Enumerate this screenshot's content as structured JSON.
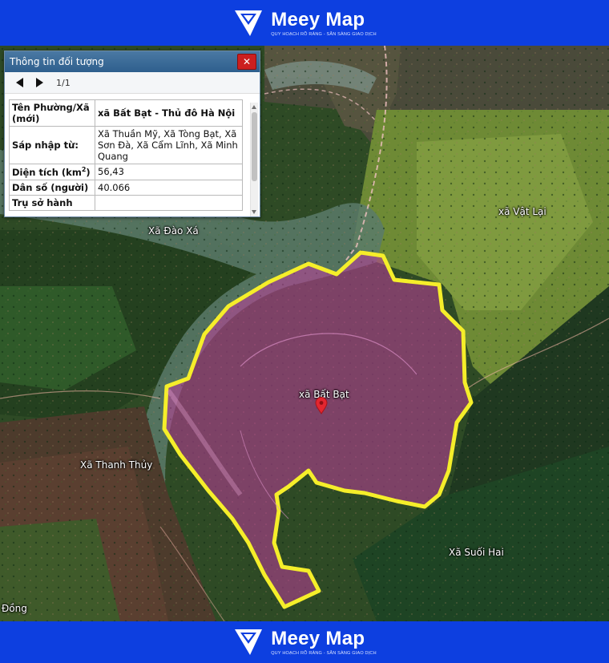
{
  "brand": {
    "name": "Meey Map",
    "tagline": "QUY HOẠCH RÕ RÀNG - SẴN SÀNG GIAO DỊCH"
  },
  "colors": {
    "banner": "#0d3fe0",
    "boundary": "#f5ee2a",
    "highlight_fill": "#c03c9c"
  },
  "map": {
    "labels": {
      "dao_xa": "Xã Đào Xá",
      "vat_lai": "xã Vật Lại",
      "bat_bat": "xã Bất Bạt",
      "thanh_thuy": "Xã Thanh Thủy",
      "suoi_hai": "Xã Suối Hai",
      "dong": "Đồng"
    },
    "marker_icon": "map-pin-icon"
  },
  "panel": {
    "title": "Thông tin đối tượng",
    "close_icon": "close-icon",
    "prev_icon": "arrow-left-icon",
    "next_icon": "arrow-right-icon",
    "page": "1/1",
    "rows": [
      {
        "key": "Tên Phường/Xã (mới)",
        "value": "xã Bất Bạt - Thủ đô Hà Nội"
      },
      {
        "key": "Sáp nhập từ:",
        "value": "Xã Thuần Mỹ, Xã Tòng Bạt, Xã Sơn Đà, Xã Cẩm Lĩnh, Xã Minh Quang"
      },
      {
        "key": "Diện tích (km²)",
        "value": "56,43"
      },
      {
        "key": "Dân số (người)",
        "value": "40.066"
      },
      {
        "key": "Trụ sở hành",
        "value": ""
      }
    ]
  }
}
